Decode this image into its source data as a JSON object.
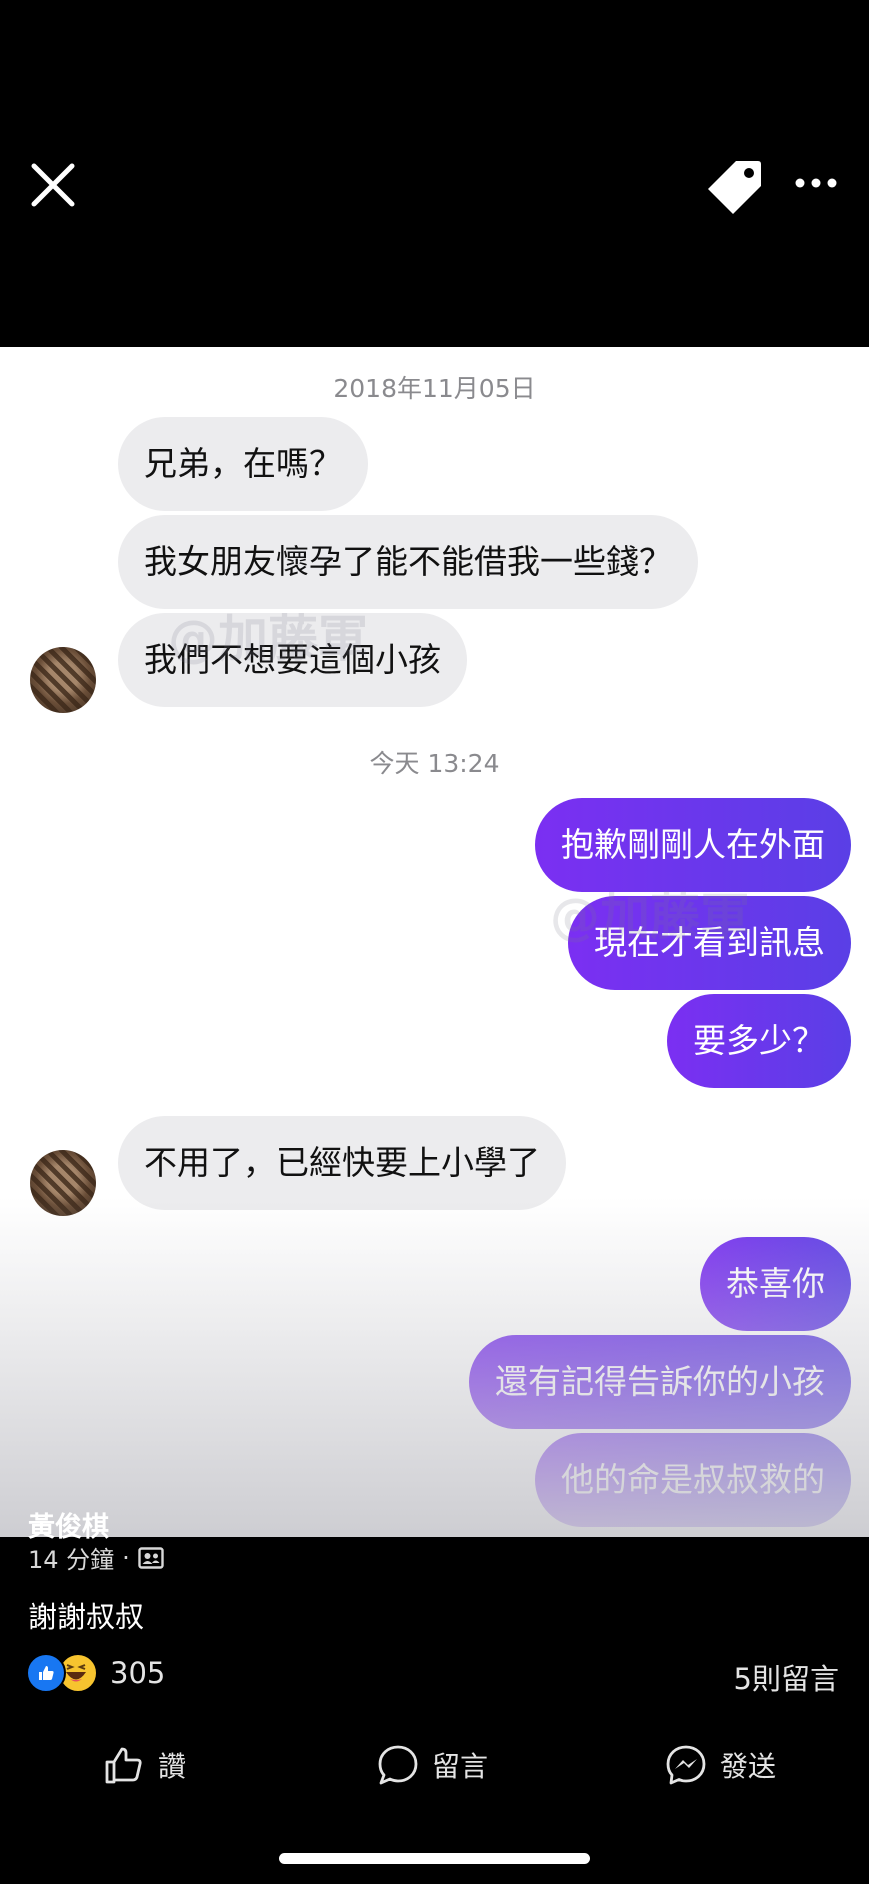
{
  "top_bar": {
    "close_icon": "close-icon",
    "tag_icon": "tag-icon",
    "more_icon": "more-options-icon"
  },
  "chat": {
    "timestamp_1": "2018年11月05日",
    "timestamp_2": "今天 13:24",
    "watermark": "@加藤軍",
    "incoming_group_1": [
      "兄弟，在嗎？",
      "我女朋友懷孕了能不能借我一些錢？",
      "我們不想要這個小孩"
    ],
    "outgoing_group_1": [
      "抱歉剛剛人在外面",
      "現在才看到訊息",
      "要多少？"
    ],
    "incoming_group_2": [
      "不用了，已經快要上小學了"
    ],
    "outgoing_group_2": [
      "恭喜你",
      "還有記得告訴你的小孩",
      "他的命是叔叔救的"
    ],
    "colors": {
      "incoming_bg": "#ececee",
      "outgoing_bg": "#6a38ee"
    }
  },
  "post": {
    "author": "黃俊棋",
    "time": "14 分鐘",
    "separator": "·",
    "privacy_icon": "friends-icon",
    "caption": "謝謝叔叔",
    "reaction_count": "305",
    "reaction_icons": [
      "like-icon",
      "haha-icon"
    ],
    "comments_count": "5則留言"
  },
  "actions": {
    "like": "讚",
    "comment": "留言",
    "send": "發送"
  }
}
